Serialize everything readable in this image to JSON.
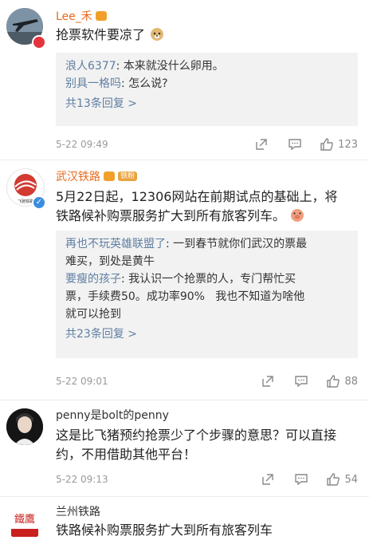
{
  "comments": [
    {
      "author": "Lee_禾",
      "text": "抢票软件要凉了",
      "replies": [
        {
          "name": "浪人6377",
          "text": ": 本来就没什么卵用。"
        },
        {
          "name": "别具一格吗",
          "text": ": 怎么说?"
        }
      ],
      "more": "共13条回复 >",
      "time": "5-22 09:49",
      "likes": "123"
    },
    {
      "author": "武汉铁路",
      "author_badge": "铁粉",
      "avatar_text": "飞驰铁路",
      "text_line1": "5月22日起，12306网站在前期试点的基础上，将",
      "text_line2": "铁路候补购票服务扩大到所有旅客列车。",
      "replies": [
        {
          "name": "再也不玩英雄联盟了",
          "text_line1": ": 一到春节就你们武汉的票最",
          "text_line2": "难买，到处是黄牛"
        },
        {
          "name": "要瘦的孩子",
          "text_line1": ": 我认识一个抢票的人，专门帮忙买",
          "text_line2": "票，手续费50。成功率90%   我也不知道为啥他",
          "text_line3": "就可以抢到"
        }
      ],
      "more": "共23条回复 >",
      "time": "5-22 09:01",
      "likes": "88"
    },
    {
      "author": "penny是bolt的penny",
      "text_line1": "这是比飞猪预约抢票少了个步骤的意思？可以直接",
      "text_line2": "约，不用借助其他平台！",
      "time": "5-22 09:13",
      "likes": "54"
    },
    {
      "author": "兰州铁路",
      "avatar_text": "鐵鷹",
      "text": "铁路候补购票服务扩大到所有旅客列车"
    }
  ]
}
